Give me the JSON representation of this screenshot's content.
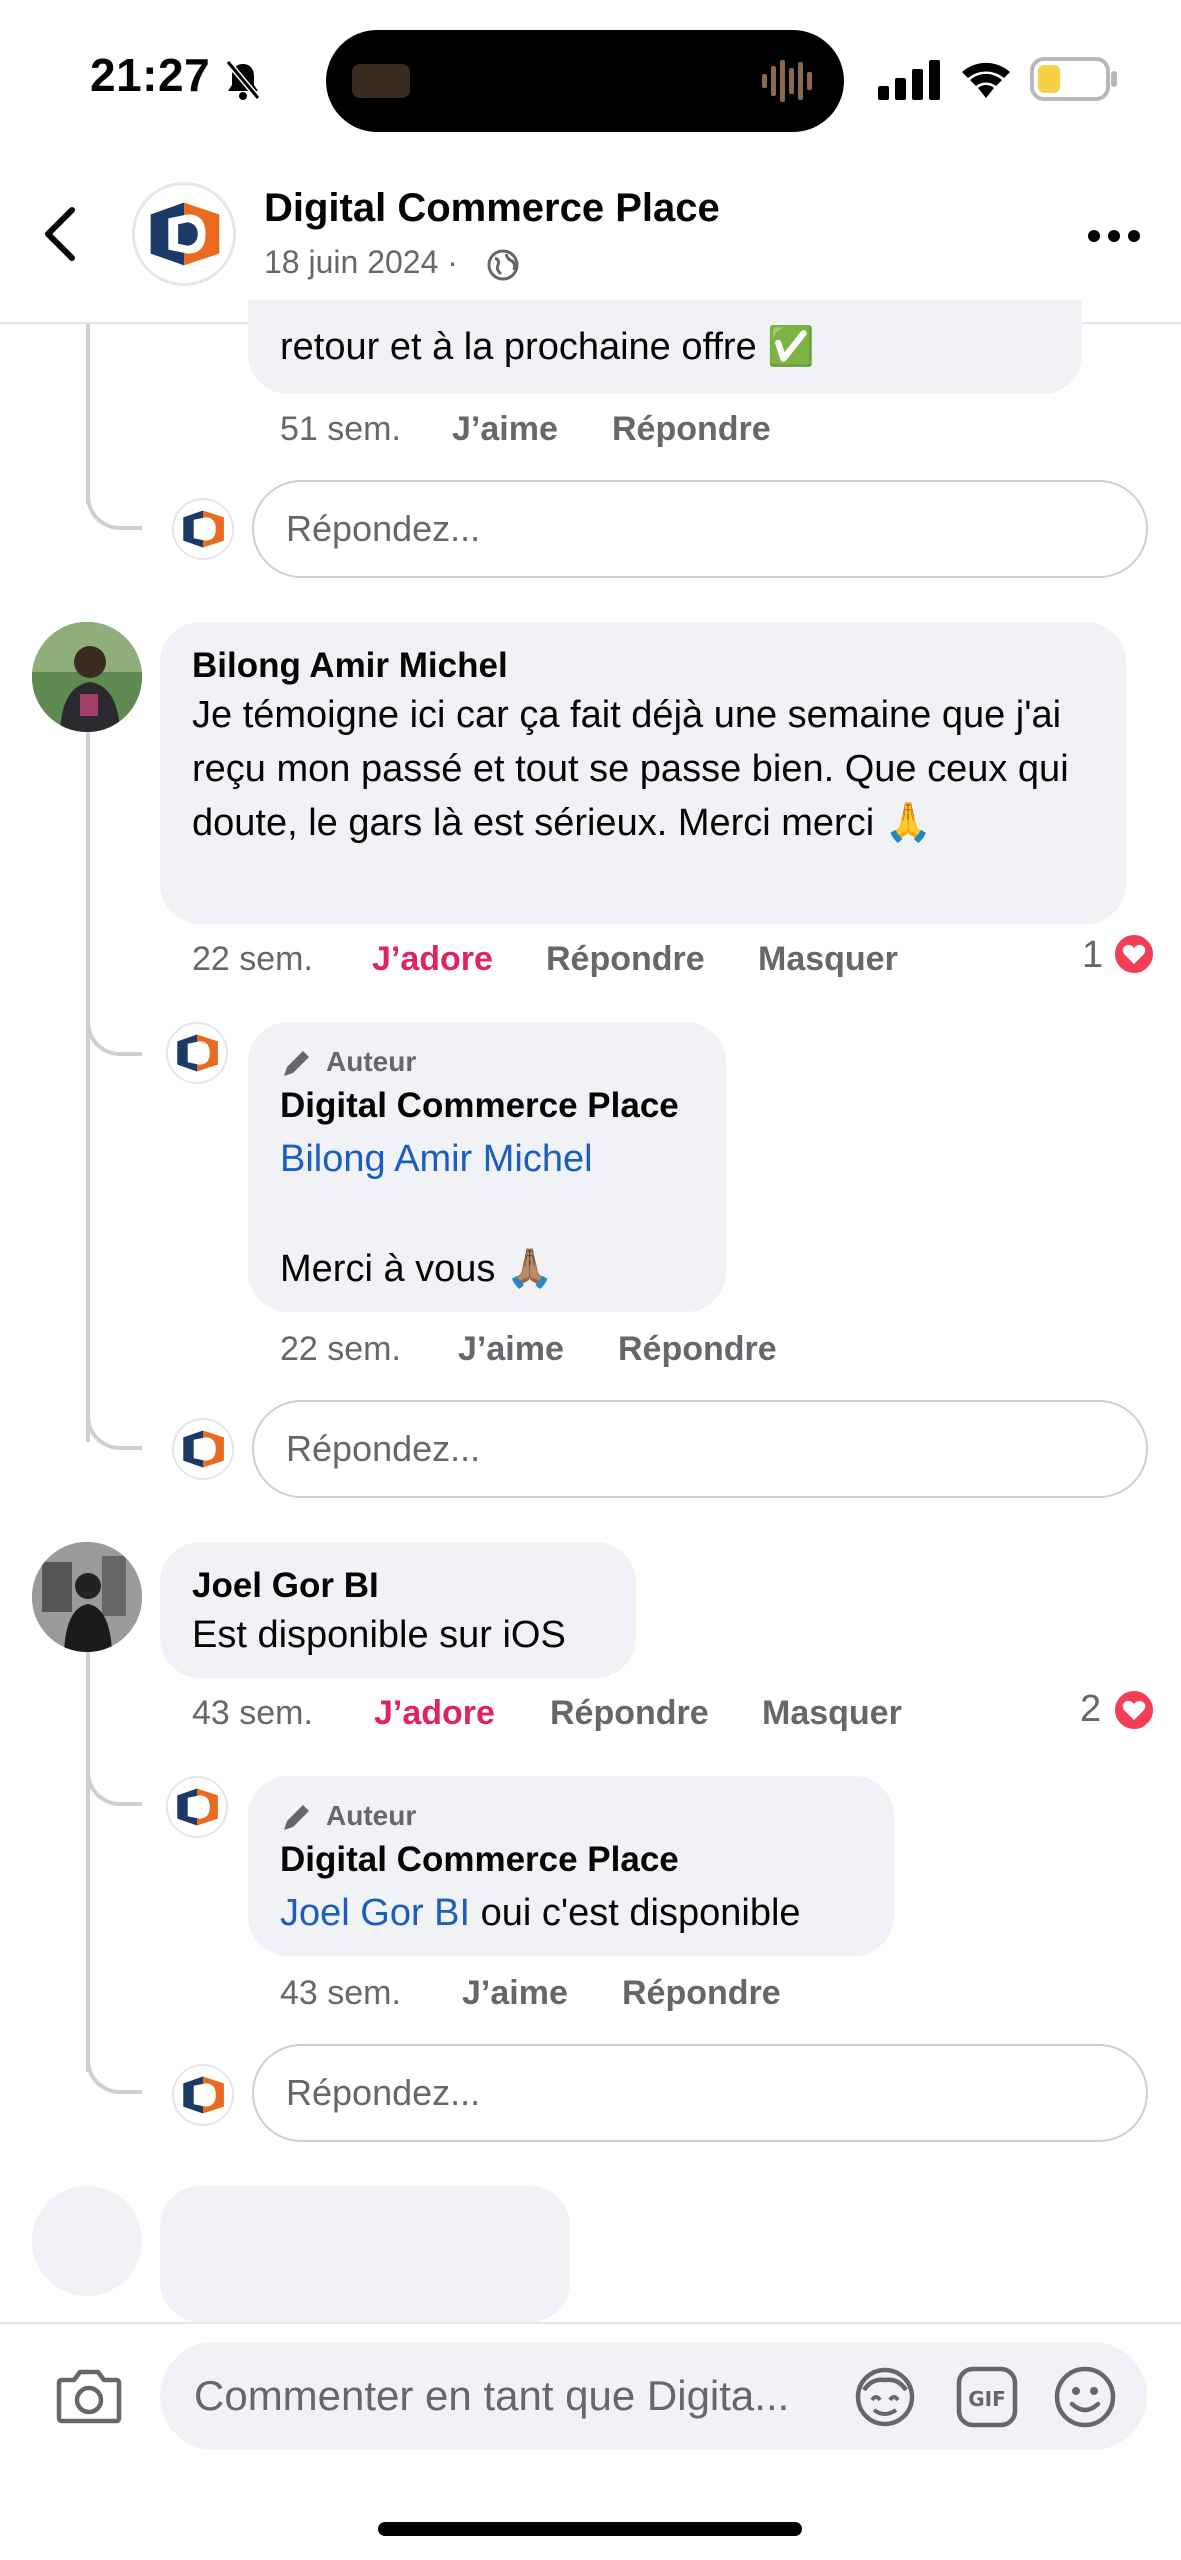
{
  "status_bar": {
    "time": "21:27",
    "battery_color": "#f7d046"
  },
  "header": {
    "title": "Digital Commerce Place",
    "date": "18 juin 2024",
    "separator": "·"
  },
  "prev_comment": {
    "text_tail": "retour et à la prochaine offre",
    "emoji": "✅",
    "time": "51 sem.",
    "like": "J’aime",
    "reply": "Répondre"
  },
  "reply_placeholder": "Répondez...",
  "comments": [
    {
      "author": "Bilong Amir Michel",
      "text": "Je témoigne ici car ça fait déjà une semaine que j'ai reçu mon passé et tout se passe bien. Que ceux qui doute, le gars là est sérieux. Merci merci 🙏",
      "time": "22 sem.",
      "reaction": "J’adore",
      "reply": "Répondre",
      "hide": "Masquer",
      "reaction_count": "1",
      "author_reply": {
        "badge": "Auteur",
        "name": "Digital Commerce Place",
        "mention": "Bilong Amir Michel",
        "text": "Merci à vous 🙏🏽",
        "time": "22 sem.",
        "like": "J’aime",
        "reply": "Répondre"
      }
    },
    {
      "author": "Joel Gor BI",
      "text": "Est disponible sur iOS",
      "time": "43 sem.",
      "reaction": "J’adore",
      "reply": "Répondre",
      "hide": "Masquer",
      "reaction_count": "2",
      "author_reply": {
        "badge": "Auteur",
        "name": "Digital Commerce Place",
        "mention": "Joel Gor BI",
        "text": "oui c'est disponible",
        "time": "43 sem.",
        "like": "J’aime",
        "reply": "Répondre"
      }
    }
  ],
  "composer": {
    "placeholder": "Commenter en tant que Digita...",
    "icons": [
      "camera-icon",
      "avatar-sticker-icon",
      "gif-icon",
      "emoji-icon"
    ]
  },
  "colors": {
    "accent_reaction": "#e0245e",
    "mention": "#1a5fbf",
    "heart": "#f33e58"
  }
}
